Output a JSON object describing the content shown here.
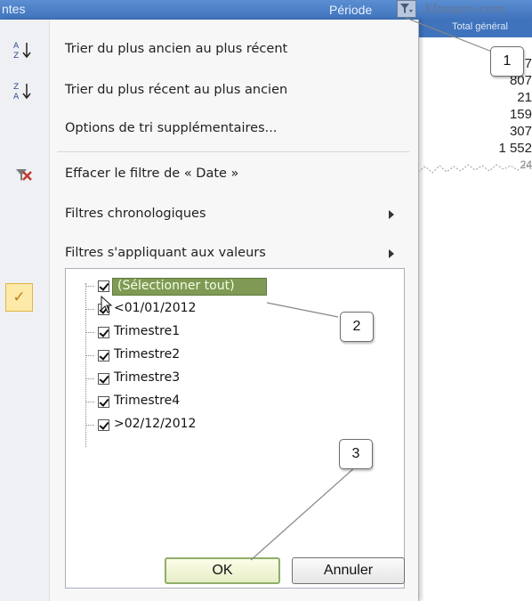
{
  "header": {
    "left_text": "ntes",
    "periode_label": "Période",
    "logo_text": "Xlpages.com",
    "subhead_text": "Total général"
  },
  "values": [
    "7",
    "807",
    "21",
    "159",
    "307",
    "1 552",
    "24"
  ],
  "menu": {
    "sort_asc": "Trier du plus ancien au plus récent",
    "sort_desc": "Trier du plus récent au plus ancien",
    "more_sort": "Options de tri supplémentaires...",
    "clear_filter": "Effacer le filtre de « Date »",
    "date_filters": "Filtres chronologiques",
    "value_filters": "Filtres s'appliquant aux valeurs"
  },
  "list": {
    "select_all": "(Sélectionner tout)",
    "items": [
      "<01/01/2012",
      "Trimestre1",
      "Trimestre2",
      "Trimestre3",
      "Trimestre4",
      ">02/12/2012"
    ]
  },
  "buttons": {
    "ok": "OK",
    "cancel": "Annuler"
  },
  "callouts": [
    "1",
    "2",
    "3"
  ],
  "colors": {
    "header_blue": "#3f73bc",
    "selection_green": "#7f9a54",
    "check_highlight": "#fde9a8"
  }
}
